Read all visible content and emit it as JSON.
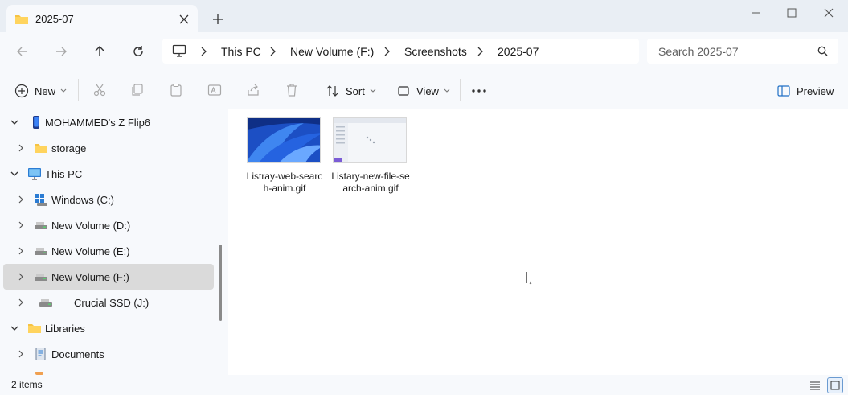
{
  "tab": {
    "title": "2025-07",
    "icon": "folder-icon"
  },
  "window": {
    "minimize": "minimize-icon",
    "maximize": "maximize-icon",
    "close": "close-icon"
  },
  "nav": {
    "breadcrumbs": [
      "This PC",
      "New Volume (F:)",
      "Screenshots",
      "2025-07"
    ],
    "search_placeholder": "Search 2025-07"
  },
  "toolbar": {
    "new_label": "New",
    "sort_label": "Sort",
    "view_label": "View",
    "more_label": "...",
    "preview_label": "Preview"
  },
  "sidebar": {
    "items": [
      {
        "label": "MOHAMMED's Z Flip6",
        "icon": "phone-icon",
        "expanded": true,
        "level": 0
      },
      {
        "label": "storage",
        "icon": "folder-icon",
        "expanded": false,
        "level": 1
      },
      {
        "label": "This PC",
        "icon": "computer-icon",
        "expanded": true,
        "level": 0
      },
      {
        "label": "Windows (C:)",
        "icon": "windows-drive-icon",
        "expanded": false,
        "level": 1
      },
      {
        "label": "New Volume (D:)",
        "icon": "drive-icon",
        "expanded": false,
        "level": 1
      },
      {
        "label": "New Volume (E:)",
        "icon": "drive-icon",
        "expanded": false,
        "level": 1
      },
      {
        "label": "New Volume (F:)",
        "icon": "drive-icon",
        "expanded": false,
        "level": 1,
        "selected": true
      },
      {
        "label": "Crucial SSD (J:)",
        "icon": "drive-icon",
        "expanded": false,
        "level": 1
      },
      {
        "label": "Libraries",
        "icon": "folder-icon",
        "expanded": true,
        "level": 0
      },
      {
        "label": "Documents",
        "icon": "documents-icon",
        "expanded": false,
        "level": 1
      }
    ]
  },
  "files": [
    {
      "name": "Listray-web-search-anim.gif"
    },
    {
      "name": "Listary-new-file-search-anim.gif"
    }
  ],
  "status": {
    "count_text": "2 items"
  },
  "colors": {
    "accent": "#0067c0",
    "selected_row": "#dadada",
    "chrome": "#f7f9fc"
  }
}
